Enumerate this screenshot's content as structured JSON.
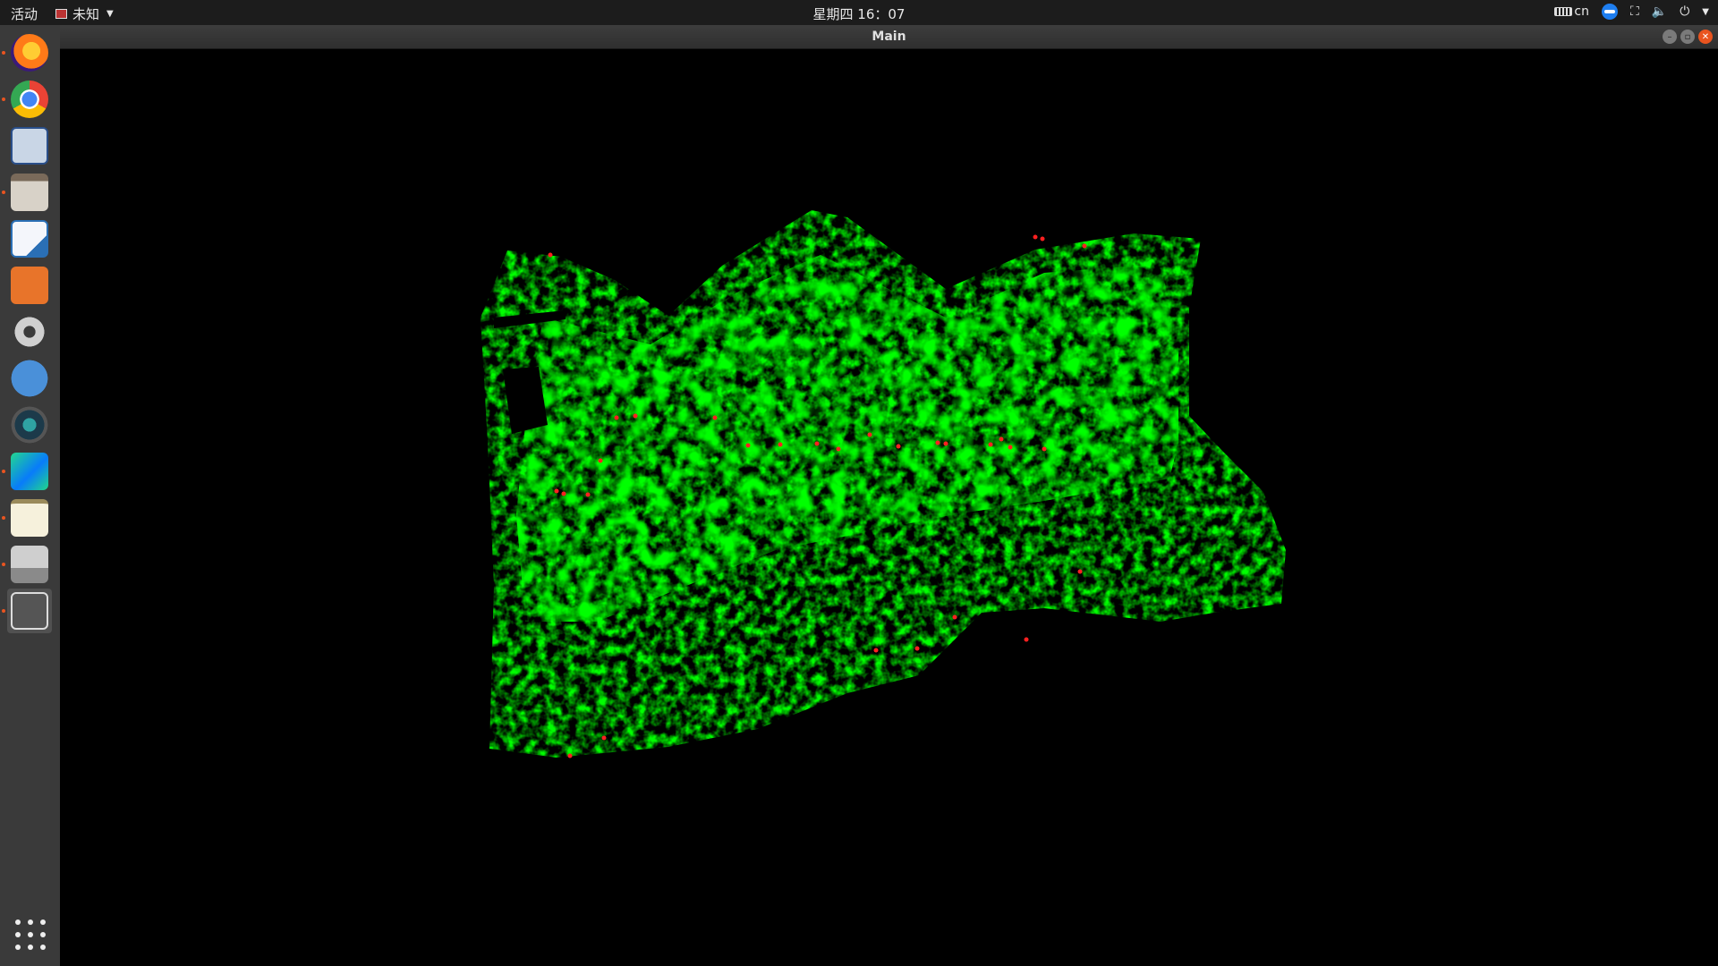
{
  "topbar": {
    "activities": "活动",
    "app_menu": "未知",
    "clock": "星期四 16：07",
    "keyboard_layout": "cn"
  },
  "window": {
    "title": "Main"
  },
  "dock": {
    "items": [
      {
        "name": "firefox-icon",
        "running": true
      },
      {
        "name": "chrome-icon",
        "running": true
      },
      {
        "name": "cloudcompare-icon",
        "running": false
      },
      {
        "name": "file-manager-icon",
        "running": true
      },
      {
        "name": "libreoffice-writer-icon",
        "running": false
      },
      {
        "name": "software-center-icon",
        "running": false
      },
      {
        "name": "system-settings-icon",
        "running": false
      },
      {
        "name": "help-icon",
        "running": false
      },
      {
        "name": "camera-app-icon",
        "running": false
      },
      {
        "name": "clion-icon",
        "running": true
      },
      {
        "name": "text-editor-icon",
        "running": true
      },
      {
        "name": "scanner-icon",
        "running": true
      },
      {
        "name": "main-app-icon",
        "running": true
      }
    ]
  },
  "colors": {
    "cloud_points": "#00ff00",
    "highlight_points": "#ff2020",
    "accent": "#e95420",
    "background": "#000000"
  }
}
